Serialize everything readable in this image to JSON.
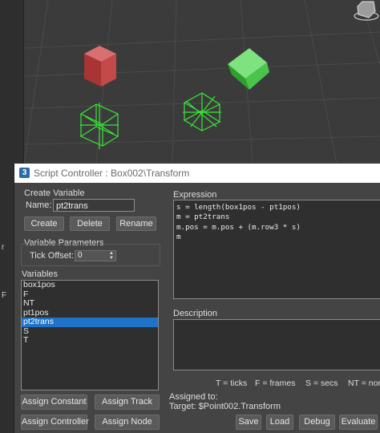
{
  "viewport": {
    "left_labels": [
      "r",
      "F"
    ]
  },
  "dialog": {
    "title": "Script Controller : Box002\\Transform",
    "create_variable": {
      "heading": "Create Variable",
      "name_label": "Name:",
      "name_value": "pt2trans",
      "create_label": "Create",
      "delete_label": "Delete",
      "rename_label": "Rename"
    },
    "variable_parameters": {
      "heading": "Variable Parameters",
      "tick_offset_label": "Tick Offset:",
      "tick_offset_value": "0"
    },
    "variables": {
      "heading": "Variables",
      "items": [
        "box1pos",
        "F",
        "NT",
        "pt1pos",
        "pt2trans",
        "S",
        "T"
      ],
      "selected": "pt2trans"
    },
    "expression": {
      "heading": "Expression",
      "lines": [
        "s = length(box1pos - pt1pos)",
        "m = pt2trans",
        "m.pos = m.pos + (m.row3 * s)",
        "m"
      ]
    },
    "description": {
      "heading": "Description",
      "text": ""
    },
    "legend": {
      "ticks": "T = ticks",
      "frames": "F = frames",
      "secs": "S = secs",
      "normal": "NT = norm"
    },
    "assigned": {
      "heading": "Assigned to:",
      "target": "Target: $Point002.Transform"
    },
    "buttons": {
      "assign_constant": "Assign Constant",
      "assign_track": "Assign Track",
      "assign_controller": "Assign Controller",
      "assign_node": "Assign Node",
      "save": "Save",
      "load": "Load",
      "debug": "Debug",
      "evaluate": "Evaluate"
    }
  }
}
